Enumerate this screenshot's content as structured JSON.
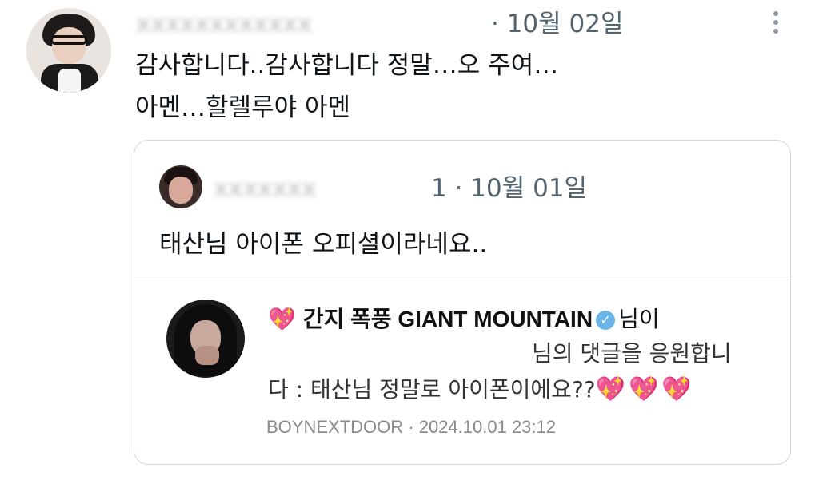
{
  "main_tweet": {
    "handle": "· 10월 02일",
    "text": "감사합니다..감사합니다 정말…오 주여…아멘…할렐루야 아멘",
    "more_icon": "more-vertical-icon"
  },
  "quoted_tweet": {
    "meta": "1 · 10월 01일",
    "text": "태산님 아이폰 오피셜이라네요.."
  },
  "nested_post": {
    "heart_icon": "sparkling-heart-icon",
    "name": "간지 폭풍 GIANT MOUNTAIN",
    "verified_icon": "verified-badge-icon",
    "suffix": "님이",
    "line2": "님의 댓글을 응원합니",
    "line3": "다 : 태산님 정말로 아이폰이에요??",
    "footer_brand": "BOYNEXTDOOR",
    "footer_sep": "·",
    "footer_time": "2024.10.01 23:12"
  },
  "colors": {
    "text": "#0f1419",
    "muted": "#536471",
    "border": "#cfd9de",
    "heart": "#e03b9a",
    "verified": "#6bb6e6"
  }
}
